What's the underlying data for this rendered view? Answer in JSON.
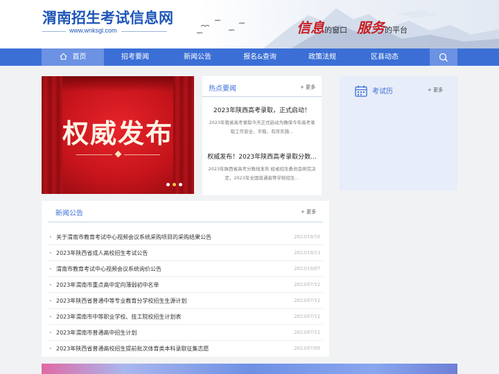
{
  "header": {
    "site_title": "渭南招生考试信息网",
    "site_url": "www.wnksgl.com",
    "slogan_word1": "信息",
    "slogan_text1": "的窗口",
    "slogan_word2": "服务",
    "slogan_text2": "的平台"
  },
  "nav": {
    "items": [
      {
        "label": "首页",
        "active": true
      },
      {
        "label": "招考要闻"
      },
      {
        "label": "新闻公告"
      },
      {
        "label": "报名&查询"
      },
      {
        "label": "政策法规"
      },
      {
        "label": "区县动态"
      }
    ],
    "search_icon": "search-icon"
  },
  "carousel": {
    "image_text": "权威发布",
    "dots": 3,
    "active_dot": 1
  },
  "hot_news": {
    "title": "热点要闻",
    "more": "+ 更多",
    "items": [
      {
        "headline": "2023年陕西高考录取，正式启动！",
        "summary": "2023年我省高考录取今天正式启动为确保今年高考录取工作安全、平稳、有序实施..."
      },
      {
        "headline": "权威发布！2023年陕西高考录取分数...",
        "summary": "2023年陕西省高考分数线发布 经省招生委员会研究决定，2023年全国普通高等学校招生..."
      }
    ]
  },
  "exam_calendar": {
    "title": "考试历",
    "more": "+ 更多",
    "icon": "calendar-icon"
  },
  "notices": {
    "title": "新闻公告",
    "more": "+ 更多",
    "rows": [
      {
        "title": "关于渭南市教育考试中心视频会议系统采购项目的采购结果公告",
        "date": "2023/10/16"
      },
      {
        "title": "2023年陕西省成人高校招生考试公告",
        "date": "2023/10/13"
      },
      {
        "title": "渭南市教育考试中心视频会议系统询价公告",
        "date": "2023/10/07"
      },
      {
        "title": "2023年渭南市重点高中定向薄弱初中名单",
        "date": "2023/07/12"
      },
      {
        "title": "2023年陕西省普通中等专业教育分学校招生生源计划",
        "date": "2023/07/12"
      },
      {
        "title": "2023年渭南市中等职业学校、技工院校招生计划表",
        "date": "2023/07/12"
      },
      {
        "title": "2023年渭南市普通高中招生计划",
        "date": "2023/07/12"
      },
      {
        "title": "2023年陕西省普通高校招生提前批次体育类本科录取征集志愿",
        "date": "2023/07/09"
      }
    ]
  },
  "colors": {
    "brand_blue": "#3b6fd6",
    "title_blue": "#1d55b8",
    "slogan_red": "#c81d24"
  }
}
